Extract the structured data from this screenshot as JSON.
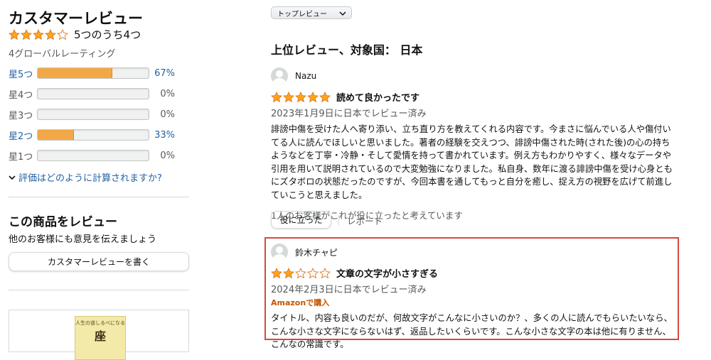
{
  "summary": {
    "title": "カスタマーレビュー",
    "rating_text": "5つのうち4つ",
    "rating": 4,
    "global_count": "4グローバルレーティング",
    "histogram": [
      {
        "label": "星5つ",
        "percent_text": "67%",
        "fraction": 0.67,
        "link": true
      },
      {
        "label": "星4つ",
        "percent_text": "0%",
        "fraction": 0,
        "link": false
      },
      {
        "label": "星3つ",
        "percent_text": "0%",
        "fraction": 0,
        "link": false
      },
      {
        "label": "星2つ",
        "percent_text": "33%",
        "fraction": 0.33,
        "link": true
      },
      {
        "label": "星1つ",
        "percent_text": "0%",
        "fraction": 0,
        "link": false
      }
    ],
    "how_link": "評価はどのように計算されますか?"
  },
  "write_review": {
    "heading": "この商品をレビュー",
    "subtext": "他のお客様にも意見を伝えましょう",
    "button_label": "カスタマーレビューを書く"
  },
  "ad": {
    "book_top_text": "人生の道しるべになる",
    "book_big_text": "座"
  },
  "sort": {
    "selected": "トップレビュー"
  },
  "reviews_heading": "上位レビュー、対象国： 日本",
  "reviews": [
    {
      "name": "Nazu",
      "stars": 5,
      "title": "読めて良かったです",
      "date": "2023年1月9日に日本でレビュー済み",
      "verified": "",
      "body": "誹謗中傷を受けた人へ寄り添い、立ち直り方を教えてくれる内容です。今まさに悩んでいる人や傷付いてる人に読んでほしいと思いました。著者の経験を交えつつ、誹謗中傷された時(された後)の心の持ちようなどを丁寧・冷静・そして愛情を持って書かれています。例え方もわかりやすく、様々なデータや引用を用いて説明されているので大変勉強になりました。私自身、数年に渡る誹謗中傷を受け心身ともにズタボロの状態だったのですが、今回本書を通してもっと自分を癒し、捉え方の視野を広げて前進していこうと思えました。",
      "helpful": "1人のお客様がこれが役に立ったと考えています",
      "helpful_button": "役に立った",
      "report": "レポート"
    },
    {
      "name": "鈴木チャピ",
      "stars": 2,
      "title": "文章の文字が小さすぎる",
      "date": "2024年2月3日に日本でレビュー済み",
      "verified": "Amazonで購入",
      "body": "タイトル、内容も良いのだが、何故文字がこんなに小さいのか？、多くの人に読んでもらいたいなら、こんな小さな文字にならないはず、返品したいくらいです。こんな小さな文字の本は他に有りません、こんなの常識です。"
    }
  ],
  "colors": {
    "star": "#ffa41c",
    "bar_fill": "#f3a847",
    "link": "#2162a1",
    "verified": "#c45500",
    "highlight_border": "#d9483b"
  }
}
